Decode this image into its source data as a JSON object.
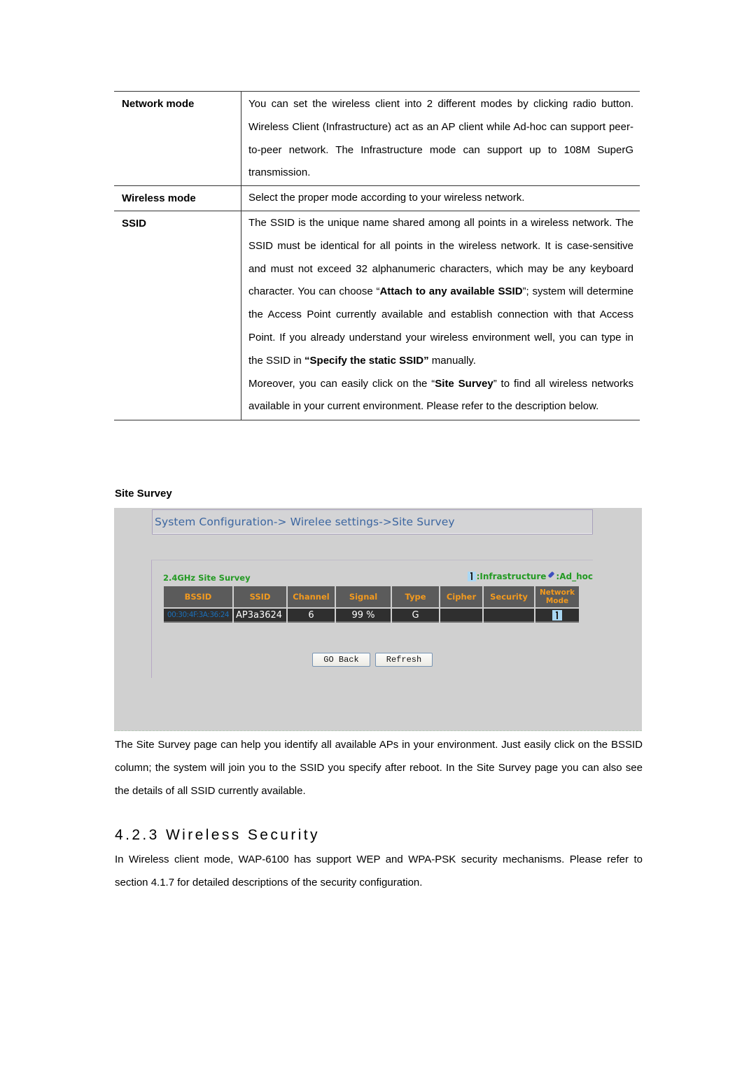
{
  "definitions": [
    {
      "term": "Network mode",
      "paragraphs": [
        [
          {
            "t": "You can set the wireless client into 2 different modes by clicking radio button. Wireless Client (Infrastructure) act as an AP client while Ad-hoc can support peer-to-peer network. The Infrastructure mode can support up to 108M SuperG transmission."
          }
        ]
      ]
    },
    {
      "term": "Wireless mode",
      "paragraphs": [
        [
          {
            "t": "Select the proper mode according to your wireless network."
          }
        ]
      ]
    },
    {
      "term": "SSID",
      "paragraphs": [
        [
          {
            "t": "The SSID is the unique name shared among all points in a wireless network. The SSID must be identical for all points in the wireless network. It is case-sensitive and must not exceed 32 alphanumeric characters, which may be any keyboard character. You can choose “"
          },
          {
            "t": "Attach to any available SSID",
            "b": true
          },
          {
            "t": "”; system will determine the Access Point currently available and establish connection with that Access Point. If you already understand your wireless environment well, you can type in the SSID in "
          },
          {
            "t": "“Specify the static SSID”",
            "b": true
          },
          {
            "t": " manually."
          }
        ],
        [
          {
            "t": "Moreover, you can easily click on the “"
          },
          {
            "t": "Site Survey",
            "b": true
          },
          {
            "t": "” to find all wireless networks available in your current environment. Please refer to the description below."
          }
        ]
      ]
    }
  ],
  "site_survey_label": "Site Survey",
  "screenshot": {
    "breadcrumb": "System Configuration-> Wirelee settings->Site Survey",
    "survey_title": "2.4GHz Site Survey",
    "legend": {
      "infrastructure_icon": "infrastructure-icon",
      "infrastructure_label": ":Infrastructure",
      "adhoc_icon": "adhoc-icon",
      "adhoc_label": ":Ad_hoc"
    },
    "columns": [
      "BSSID",
      "SSID",
      "Channel",
      "Signal",
      "Type",
      "Cipher",
      "Security",
      "Network Mode"
    ],
    "rows": [
      {
        "bssid": "00:30:4F:3A:36:24",
        "ssid": "AP3a3624",
        "channel": "6",
        "signal": "99 %",
        "type": "G",
        "cipher": "",
        "security": "",
        "network_mode_icon": "infrastructure-icon"
      }
    ],
    "buttons": {
      "go_back": "GO Back",
      "refresh": "Refresh"
    },
    "colors": {
      "breadcrumb": "#3c66a0",
      "survey_title": "#239a23",
      "header_text": "#f39a1e",
      "header_bg": "#5b5b5b",
      "row_bg": "#2f2f2f",
      "bssid_link": "#1c6fb8",
      "panel_bg": "#d0d0d0"
    }
  },
  "paragraph_site_survey": "The Site Survey page can help you identify all available APs in your environment. Just easily click on the BSSID column; the system will join you to the SSID you specify after reboot. In the Site Survey page you can also see the details of all SSID currently available.",
  "section_heading": "4.2.3 Wireless Security",
  "paragraph_security": "In Wireless client mode, WAP-6100 has support WEP and WPA-PSK security mechanisms. Please refer to section 4.1.7 for detailed descriptions of the security configuration."
}
